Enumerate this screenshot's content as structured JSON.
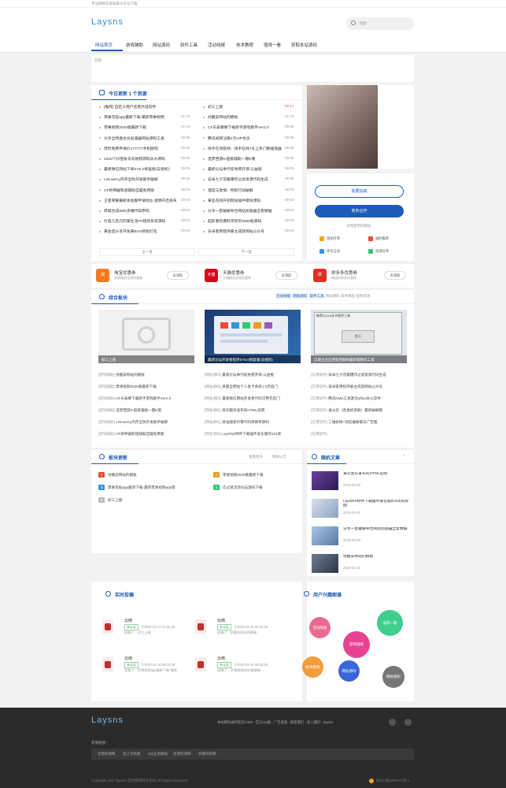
{
  "topbar": {
    "slogan": "专注网络资源收集分享与下载"
  },
  "header": {
    "logo": "Laysns",
    "search_placeholder": "搜索",
    "nav": [
      "网站首页",
      "游戏辅助",
      "网站源码",
      "软件工具",
      "活动线报",
      "技术教程",
      "值得一看",
      "获取本站源码"
    ]
  },
  "banner": {
    "alt": "云雨"
  },
  "today": {
    "title": "今日更新 1 个资源",
    "left": [
      {
        "text": "[推荐] 自定义用户名者外挂软件",
        "date": ""
      },
      {
        "text": "苹果花贴app最新下载-最新苹果视频",
        "date": "02-15"
      },
      {
        "text": "苹果视频2020版最新下载",
        "date": "02-15"
      },
      {
        "text": "分享全网盘会员加速器网站源码工具",
        "date": "08-05"
      },
      {
        "text": "周时免费申请价177777手机版阿",
        "date": "08-05"
      },
      {
        "text": "2400个抖音账号去视频源码去水源码",
        "date": "08-05"
      },
      {
        "text": "最新微信网站下单SY5.0修复版(去授权)",
        "date": "08-05"
      },
      {
        "text": "LOLwerry内存全防开发助手破解",
        "date": "08-05"
      },
      {
        "text": "CF新神器和迷辅助自瞄免费版",
        "date": "08-03"
      },
      {
        "text": "王者荣耀最新体验服申请地址 透明开启发布",
        "date": "08-03"
      },
      {
        "text": "商城合成Web多端代码原码",
        "date": "08-03"
      },
      {
        "text": "价值几百元的某生活FR租赁系统源码",
        "date": "08-03"
      },
      {
        "text": "某金蛋分享开发某BOX新版打包",
        "date": "08-03"
      }
    ],
    "right": [
      {
        "text": "初三上册",
        "date": "02-17"
      },
      {
        "text": "仿酷安网站的模板",
        "date": "02-15"
      },
      {
        "text": "CF乐泰攀攀下载新手游戏助手Ver2.0",
        "date": "08-05"
      },
      {
        "text": "腾讯视频注册0元VIP会员",
        "date": "08-05"
      },
      {
        "text": "快手在领取线：快手在线7天上热门刷播放器",
        "date": "08-05"
      },
      {
        "text": "造梦西游5-超级辅助一键E瑞",
        "date": "08-05"
      },
      {
        "text": "最新论坛举代技免费开源-公益版",
        "date": "08-05"
      },
      {
        "text": "安卓七夕花瓣爆炸过滤资源代码生成",
        "date": "08-05"
      },
      {
        "text": "速度与激情：特别行动破解",
        "date": "08-03"
      },
      {
        "text": "某监花线开扣网站插件模块源码",
        "date": "08-03"
      },
      {
        "text": "分享一套破解导合网站加速器全套数据",
        "date": "08-03"
      },
      {
        "text": "超影者的爆料项目页3000秘源码",
        "date": "08-03"
      },
      {
        "text": "安卓家用程序雇主成就网站公众号",
        "date": "08-03"
      }
    ],
    "prev": "上一页",
    "next": "下一页"
  },
  "side_top": {
    "btn1": "我要投稿",
    "btn2": "商务合作",
    "label": "文档使用的网站",
    "links": [
      "添加打赏",
      "福利推荐",
      "评论互动",
      "资源分享"
    ]
  },
  "promos": [
    {
      "name": "淘宝优惠券",
      "desc": "卖家精选全网优惠券",
      "btn": "去领取",
      "color": "#f57a1f",
      "icon": "淘"
    },
    {
      "name": "天猫优惠券",
      "desc": "天猫精选全网优惠券",
      "btn": "去领取",
      "color": "#d9001b",
      "icon": "天猫"
    },
    {
      "name": "拼多多优惠券",
      "desc": "精选拼多多优惠券",
      "btn": "去领取",
      "color": "#e02e24",
      "icon": "拼"
    }
  ],
  "comprehensive": {
    "title": "综合板块",
    "tabs": [
      "活动线报",
      "网站源码",
      "软件工具",
      "网站源码",
      "技术教程",
      "福利资源"
    ],
    "cards": [
      {
        "caption": "初三上册"
      },
      {
        "caption": "最新论坛开发者程序SY5.0修复版(去授权)"
      },
      {
        "caption": "云雨企业应用程序解除最新版制作工具"
      }
    ],
    "dialog": {
      "title": "推荐以GUI证书程序工具",
      "btn": "注入"
    },
    "col1": [
      {
        "cat": "[游戏辅助]",
        "text": "仿酷安网站的模板"
      },
      {
        "cat": "[游戏辅助]",
        "text": "苹果视频2020版最新下载"
      },
      {
        "cat": "[游戏辅助]",
        "text": "CF乐泰攀下载新手游戏助手Ver2.0"
      },
      {
        "cat": "[游戏辅助]",
        "text": "造梦西游5-超级辅助一键E瑞"
      },
      {
        "cat": "[游戏辅助]",
        "text": "LOLwerry内存全防开发助手破解"
      },
      {
        "cat": "[游戏辅助]",
        "text": "CF新神器和迷辅助自瞄免费版"
      }
    ],
    "col2": [
      {
        "cat": "[网站源码]",
        "text": "最新论坛举代技免费开源-公益版"
      },
      {
        "cat": "[网站源码]",
        "text": "某最全网站个人发卡系统1.0无后门"
      },
      {
        "cat": "[网站源码]",
        "text": "最新微信网站开发者代码可用无后门"
      },
      {
        "cat": "[网站源码]",
        "text": "某云服务发布的HTML说明"
      },
      {
        "cat": "[网站源码]",
        "text": "某站搜索引擎代码转换带源码"
      },
      {
        "cat": "[网站源码]",
        "text": "LaySNS附件下载插件美化版的115源"
      }
    ],
    "col3": [
      {
        "cat": "[实用软件]",
        "text": "安卓七夕花瓣爆炸过滤资源代码生成"
      },
      {
        "cat": "[实用软件]",
        "text": "安卓家用程序雇主成就网站公众号"
      },
      {
        "cat": "[实用软件]",
        "text": "腾讯KMS工具激活office办公软件"
      },
      {
        "cat": "[实用软件]",
        "text": "金山云（各类机场款）最新破解版"
      },
      {
        "cat": "[实用软件]",
        "text": "二维表情+动态破解版去广告版"
      },
      {
        "cat": "[实用软件]",
        "text": ""
      }
    ]
  },
  "board_update": {
    "title": "板块更新",
    "links": [
      "查看更多",
      "网站公告"
    ],
    "items": [
      {
        "n": "1",
        "text": "仿酷安网站的模板",
        "color": "#e74c3c"
      },
      {
        "n": "2",
        "text": "苹果视频2020版最新下载",
        "color": "#f39c12"
      },
      {
        "n": "3",
        "text": "苹果花贴app最新下载-最新苹果视频app客",
        "color": "#3498db"
      },
      {
        "n": "4",
        "text": "云过某活动论坛源码下载",
        "color": "#2ecc71"
      },
      {
        "n": "5",
        "text": "初三上册",
        "color": "#bbb"
      }
    ]
  },
  "random": {
    "title": "随机文章",
    "items": [
      {
        "title": "某云音乐发布的HTML官网",
        "date": "2019-08-03"
      },
      {
        "title": "LaySNS附件下载插件美化版的115资源网",
        "date": "2019-08-02"
      },
      {
        "title": "分享一套破解导合网站加速器全套数据",
        "date": "2019-08-03"
      },
      {
        "title": "仿酷安网站的模板",
        "date": "2020-02-15"
      }
    ]
  },
  "realtime": {
    "title": "实时投稿",
    "posts": [
      {
        "name": "云雨",
        "tag": "未认证",
        "time": "于2020-02-17 01:02:48",
        "desc": "投稿了：初三上册"
      },
      {
        "name": "云雨",
        "tag": "未认证",
        "time": "于2020-02-15 05:02:48",
        "desc": "投稿了：仿酷安网站的模板"
      },
      {
        "name": "云雨",
        "tag": "未认证",
        "time": "于2020-02-15 05:02:08",
        "desc": "投稿了：苹果视频app最新下载-最新"
      },
      {
        "name": "云雨",
        "tag": "未认证",
        "time": "于2020-02-15 05:02:46",
        "desc": "投稿了：苹果视频2020版最新"
      }
    ]
  },
  "interest": {
    "title": "用户兴趣图谱",
    "bubbles": [
      "活动线报",
      "值得一看",
      "游戏辅助",
      "技术教程",
      "网站源码",
      "网站源码"
    ]
  },
  "footer": {
    "logo": "Laysns",
    "links": [
      "本站网页由阿里云/CDN",
      "官方QQ群",
      "广告投放",
      "联系我们",
      "加入我们",
      "laysns"
    ],
    "friends_label": "友情链接：",
    "friends": [
      "云雨资源网",
      "爱上导航网",
      "QQ业务网站",
      "资源资源网",
      "云端导航网"
    ],
    "copyright": "Copyright 2017 laysns 互联网源码分享站 All Rights Reserved",
    "icp": "皖ICP备1980277号-1"
  }
}
